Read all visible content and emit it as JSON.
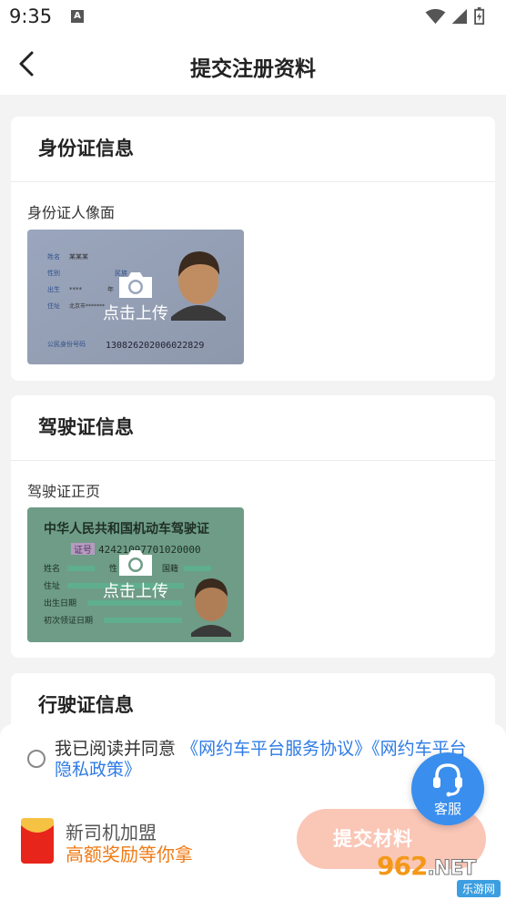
{
  "status_bar": {
    "time": "9:35",
    "notification_icon": "a-icon",
    "icons": [
      "wifi-icon",
      "signal-icon",
      "battery-icon"
    ]
  },
  "header": {
    "title": "提交注册资料",
    "back_icon": "chevron-left-icon"
  },
  "sections": [
    {
      "title": "身份证信息",
      "photo_label": "身份证人像面",
      "upload_text": "点击上传",
      "sample": {
        "fields": [
          "姓名",
          "性别",
          "民族",
          "出生",
          "年",
          "住址"
        ],
        "name_value": "某某某",
        "birth_value": "****",
        "address_value": "北京市*******",
        "id_label": "公民身份号码",
        "id_number": "130826202006022829"
      }
    },
    {
      "title": "驾驶证信息",
      "photo_label": "驾驶证正页",
      "upload_text": "点击上传",
      "sample": {
        "heading": "中华人民共和国机动车驾驶证",
        "cert_label": "证号",
        "cert_number": "42421097701020000",
        "fields": [
          "姓名",
          "性",
          "国籍",
          "住址",
          "出生日期",
          "初次领证日期"
        ]
      }
    },
    {
      "title": "行驶证信息"
    }
  ],
  "agreement": {
    "prefix": "我已阅读并同意",
    "link1": "《网约车平台服务协议》",
    "link2": "《网约车平台隐私政策》"
  },
  "promo": {
    "line1": "新司机加盟",
    "line2": "高额奖励等你拿"
  },
  "submit_label": "提交材料",
  "customer_service_label": "客服",
  "watermark": {
    "brand": "962",
    "domain": ".NET",
    "site": "乐游网"
  },
  "colors": {
    "accent": "#2d7be5",
    "promo_orange": "#f07a14",
    "submit_bg": "#fac6b6",
    "service_blue": "#3a8eee"
  }
}
